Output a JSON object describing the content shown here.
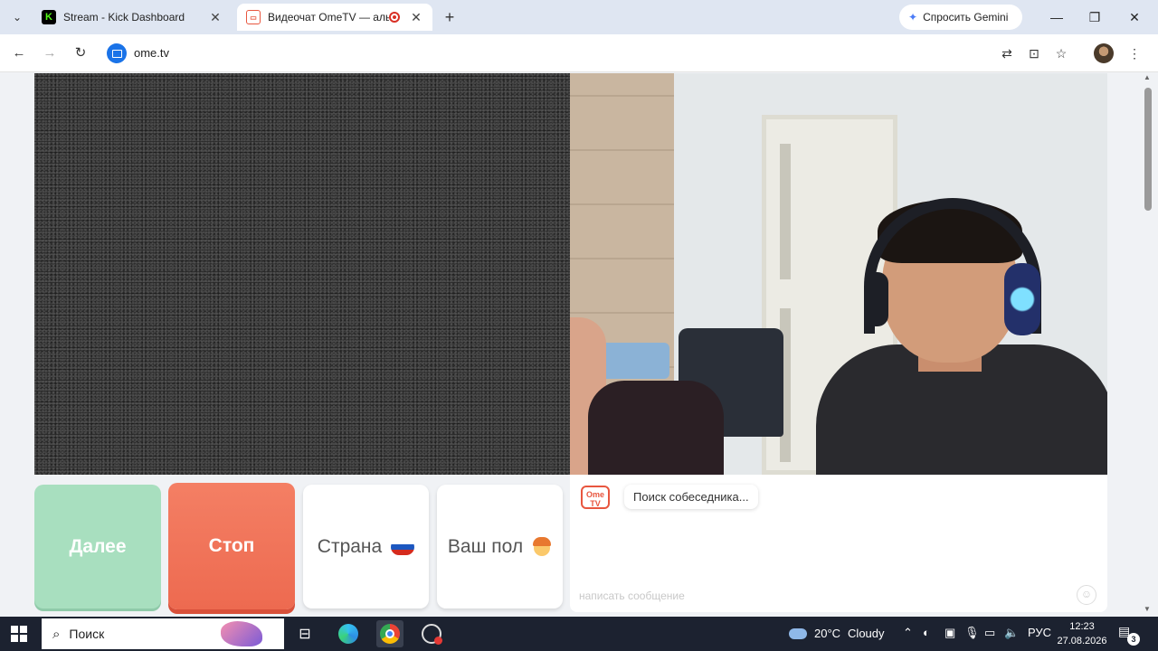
{
  "browser": {
    "tabs": [
      {
        "title": "Stream - Kick Dashboard",
        "favicon": "kick-logo-icon"
      },
      {
        "title": "Видеочат OmeTV — альте",
        "favicon": "ometv-logo-icon",
        "recording": true
      }
    ],
    "gemini_label": "Спросить Gemini",
    "url": "ome.tv"
  },
  "page": {
    "buttons": {
      "next": "Далее",
      "stop": "Стоп",
      "country": "Страна",
      "gender": "Ваш пол"
    },
    "chat": {
      "logo_text": "Ome TV",
      "status": "Поиск собеседника...",
      "input_placeholder": "написать сообщение"
    }
  },
  "taskbar": {
    "search_label": "Поиск",
    "weather_temp": "20°C",
    "weather_cond": "Cloudy",
    "lang": "РУС",
    "time": "12:23",
    "date": "27.08.2026",
    "notification_count": "3"
  },
  "colors": {
    "next_button": "#a8dfbf",
    "stop_button": "#ed6a50",
    "brand": "#e8563f"
  }
}
